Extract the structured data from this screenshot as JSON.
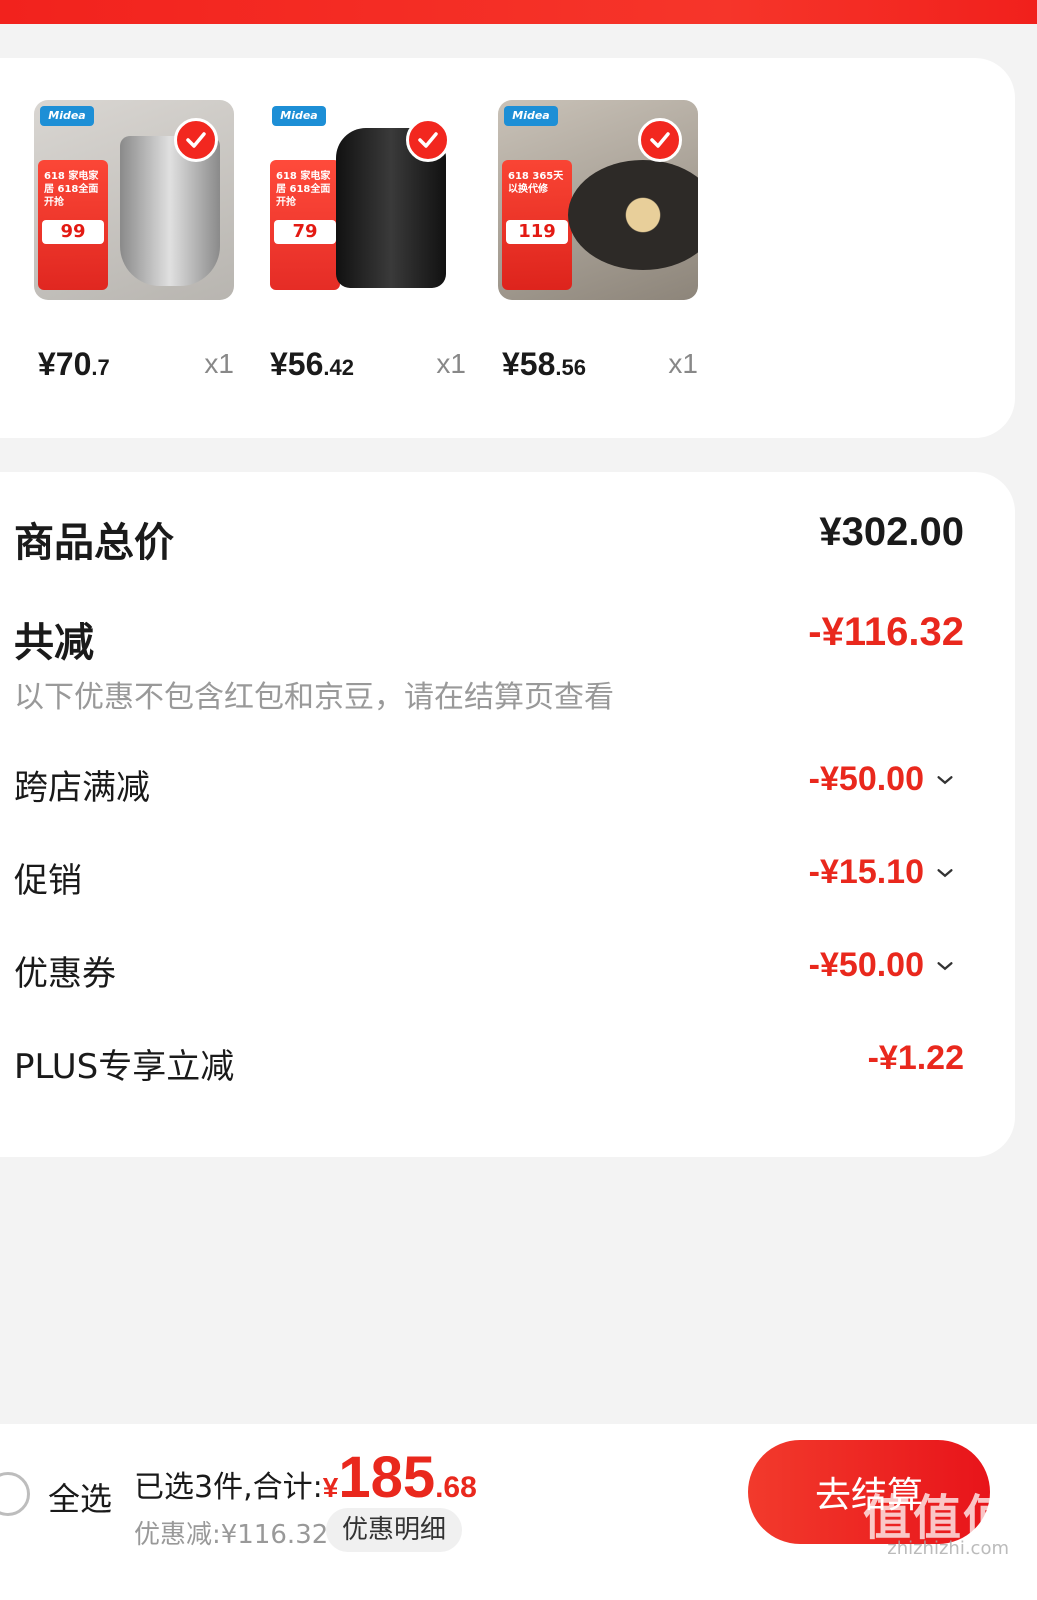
{
  "products": [
    {
      "brand": "Midea",
      "promo_label": "618 家电家居 618全面开抢",
      "promo_price": "99",
      "price_int": "¥70",
      "price_dec": ".7",
      "qty": "x1"
    },
    {
      "brand": "Midea",
      "promo_label": "618 家电家居 618全面开抢",
      "promo_price": "79",
      "price_int": "¥56",
      "price_dec": ".42",
      "qty": "x1"
    },
    {
      "brand": "Midea",
      "promo_label": "618 365天以换代修",
      "promo_price": "119",
      "price_int": "¥58",
      "price_dec": ".56",
      "qty": "x1"
    }
  ],
  "summary": {
    "total_label": "商品总价",
    "total_value": "¥302.00",
    "reduce_label": "共减",
    "reduce_value": "-¥116.32",
    "note": "以下优惠不包含红包和京豆，请在结算页查看",
    "items": [
      {
        "label": "跨店满减",
        "value": "-¥50.00"
      },
      {
        "label": "促销",
        "value": "-¥15.10"
      },
      {
        "label": "优惠券",
        "value": "-¥50.00"
      },
      {
        "label": "PLUS专享立减",
        "value": "-¥1.22"
      }
    ]
  },
  "bottom": {
    "select_all": "全选",
    "selected_text": "已选3件,合计:",
    "yen": "¥",
    "total_int": "185",
    "total_dec": ".68",
    "discount_text": "优惠减:¥116.32",
    "detail_label": "优惠明细",
    "checkout_label": "去结算"
  },
  "watermark": {
    "text": "值值值",
    "url": "zhizhizhi.com"
  },
  "colors": {
    "accent": "#e9281d",
    "top_bar": "#f2221d"
  }
}
